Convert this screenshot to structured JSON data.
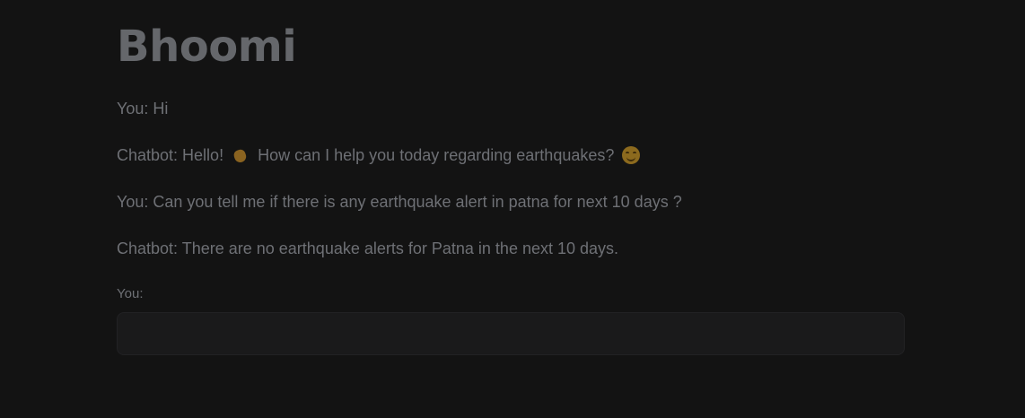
{
  "app": {
    "title": "Bhoomi"
  },
  "conversation": [
    {
      "speaker": "You",
      "text": "You: Hi"
    },
    {
      "speaker": "Chatbot",
      "text_before": "Chatbot: Hello!",
      "emoji_1": "waving-hand",
      "text_middle": "How can I help you today regarding earthquakes?",
      "emoji_2": "smiling-face"
    },
    {
      "speaker": "You",
      "text": "You: Can you tell me if there is any earthquake alert in patna for next 10 days ?"
    },
    {
      "speaker": "Chatbot",
      "text": "Chatbot: There are no earthquake alerts for Patna in the next 10 days."
    }
  ],
  "input": {
    "label": "You:",
    "value": ""
  },
  "colors": {
    "background": "#131313",
    "text": "#6e7075",
    "input_background": "#1a1a1b"
  }
}
